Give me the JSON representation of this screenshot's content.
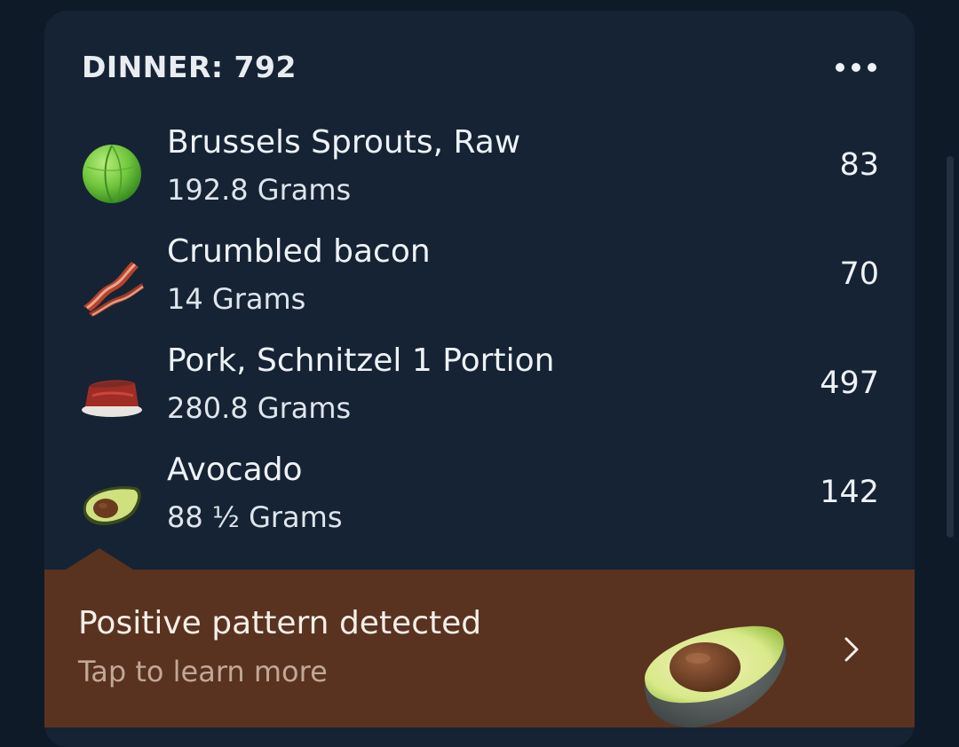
{
  "meal": {
    "title": "DINNER: 792",
    "more_icon": "more-horizontal-icon"
  },
  "foods": [
    {
      "name": "Brussels Sprouts, Raw",
      "amount": "192.8 Grams",
      "calories": "83",
      "icon": "brussels-sprout-icon"
    },
    {
      "name": "Crumbled bacon",
      "amount": "14 Grams",
      "calories": "70",
      "icon": "bacon-icon"
    },
    {
      "name": "Pork, Schnitzel 1 Portion",
      "amount": "280.8 Grams",
      "calories": "497",
      "icon": "meat-icon"
    },
    {
      "name": "Avocado",
      "amount": "88 ½ Grams",
      "calories": "142",
      "icon": "avocado-icon"
    }
  ],
  "insight": {
    "title": "Positive pattern detected",
    "subtitle": "Tap to learn more",
    "icon": "avocado-icon",
    "chevron_icon": "chevron-right-icon"
  },
  "colors": {
    "background": "#0f1a28",
    "card": "#162334",
    "banner": "#5a3220",
    "text": "#eef2f6",
    "banner_subtext": "#bfa898"
  }
}
